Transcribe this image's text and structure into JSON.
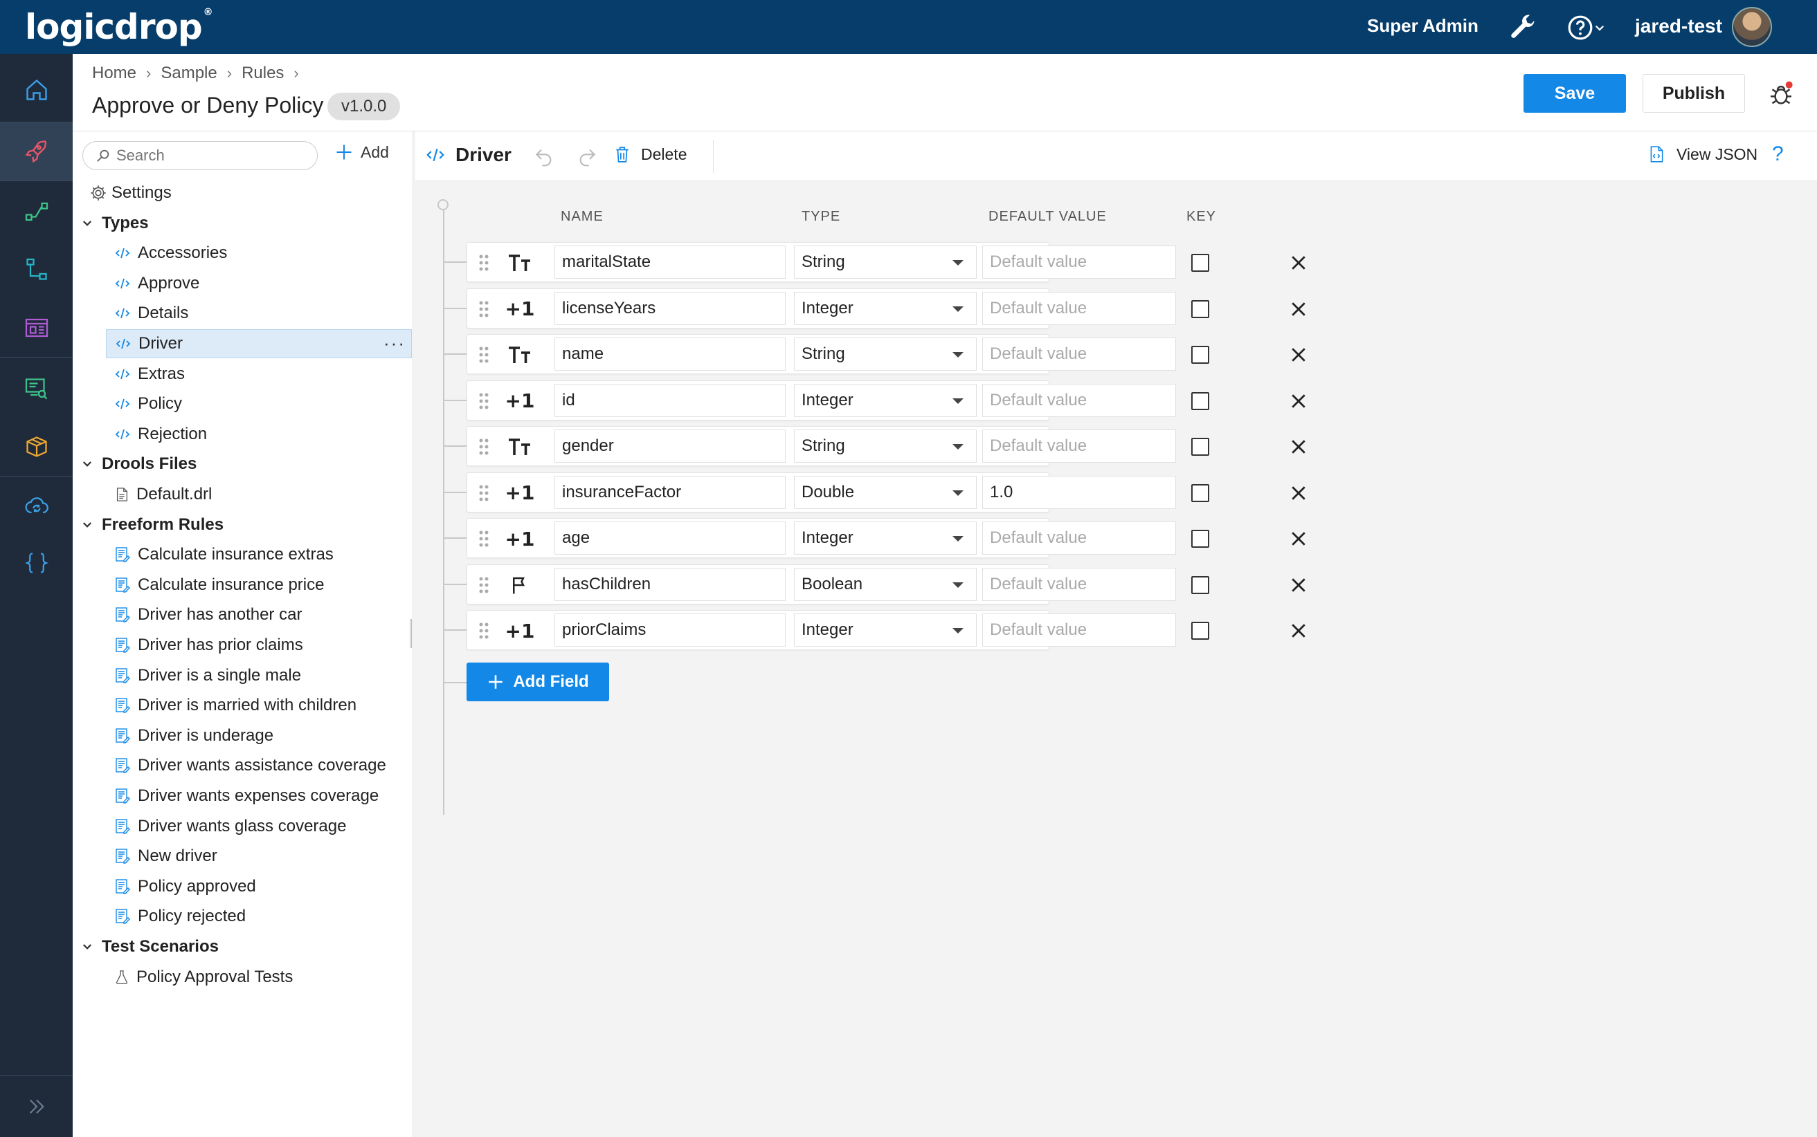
{
  "topbar": {
    "logo": "logicdrop",
    "logo_mark": "®",
    "role": "Super Admin",
    "user": "jared-test"
  },
  "header": {
    "breadcrumbs": [
      "Home",
      "Sample",
      "Rules"
    ],
    "title": "Approve or Deny Policy",
    "version": "v1.0.0",
    "save_label": "Save",
    "publish_label": "Publish",
    "more_label": "···"
  },
  "sidebar": {
    "search_placeholder": "Search",
    "add_label": "Add",
    "settings_label": "Settings",
    "groups": [
      {
        "label": "Types",
        "items": [
          "Accessories",
          "Approve",
          "Details",
          "Driver",
          "Extras",
          "Policy",
          "Rejection"
        ]
      },
      {
        "label": "Drools Files",
        "items": [
          "Default.drl"
        ]
      },
      {
        "label": "Freeform Rules",
        "items": [
          "Calculate insurance extras",
          "Calculate insurance price",
          "Driver has another car",
          "Driver has prior claims",
          "Driver is a single male",
          "Driver is married with children",
          "Driver is underage",
          "Driver wants assistance coverage",
          "Driver wants expenses coverage",
          "Driver wants glass coverage",
          "New driver",
          "Policy approved",
          "Policy rejected"
        ]
      },
      {
        "label": "Test Scenarios",
        "items": [
          "Policy Approval Tests"
        ]
      }
    ],
    "selected_item": "Driver",
    "row_more": "···"
  },
  "editor": {
    "title": "Driver",
    "delete_label": "Delete",
    "view_json_label": "View JSON",
    "help_label": "?",
    "columns": {
      "name": "NAME",
      "type": "TYPE",
      "default": "DEFAULT VALUE",
      "key": "KEY"
    },
    "default_placeholder": "Default value",
    "fields": [
      {
        "glyph": "Tт",
        "name": "maritalState",
        "type": "String",
        "default": ""
      },
      {
        "glyph": "+1",
        "name": "licenseYears",
        "type": "Integer",
        "default": ""
      },
      {
        "glyph": "Tт",
        "name": "name",
        "type": "String",
        "default": ""
      },
      {
        "glyph": "+1",
        "name": "id",
        "type": "Integer",
        "default": ""
      },
      {
        "glyph": "Tт",
        "name": "gender",
        "type": "String",
        "default": ""
      },
      {
        "glyph": "+1",
        "name": "insuranceFactor",
        "type": "Double",
        "default": "1.0"
      },
      {
        "glyph": "+1",
        "name": "age",
        "type": "Integer",
        "default": ""
      },
      {
        "glyph": "flag",
        "name": "hasChildren",
        "type": "Boolean",
        "default": ""
      },
      {
        "glyph": "+1",
        "name": "priorClaims",
        "type": "Integer",
        "default": ""
      }
    ],
    "add_field_label": "Add Field"
  },
  "colors": {
    "topbar": "#063d6b",
    "rail": "#1f2b3a",
    "accent": "#1488e6",
    "selected_row": "#dcebf7"
  },
  "icons": {
    "rail": [
      "home-icon",
      "rocket-icon",
      "flow-icon",
      "hierarchy-icon",
      "layout-icon",
      "monitor-search-icon",
      "package-icon",
      "cloud-sync-icon",
      "braces-icon",
      "expand-icon"
    ]
  }
}
